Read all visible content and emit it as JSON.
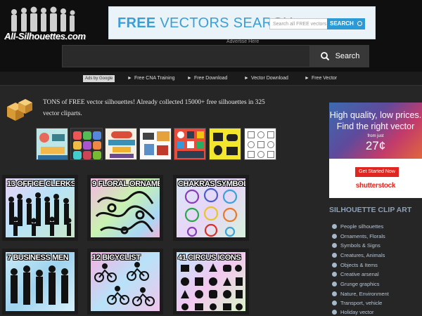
{
  "site": {
    "logo_text": "All-Silhouettes.com"
  },
  "ad_banner": {
    "prefix": "FREE",
    "rest": " VECTORS SEARCH",
    "input_placeholder": "Search all FREE vectors",
    "button_label": "SEARCH",
    "note": "Advertise Here"
  },
  "search": {
    "button_label": "Search",
    "value": ""
  },
  "link_bar": {
    "adchoices": "Ads by Google",
    "links": [
      "Free CNA Training",
      "Free Download",
      "Vector Download",
      "Free Vector"
    ]
  },
  "intro": {
    "text": "TONS of FREE vector silhouettes! Already collected 15000+ free silhouettes in 325 vector cliparts."
  },
  "cards": [
    {
      "title": "13 OFFICE CLERKS"
    },
    {
      "title": "9 FLORAL ORNAMENTS"
    },
    {
      "title": "CHAKRAS SYMBOLS"
    },
    {
      "title": "7 BUSINESS MEN"
    },
    {
      "title": "12 BICYCLIST"
    },
    {
      "title": "41 CIRCUS ICONS"
    }
  ],
  "promo": {
    "headline_1": "High quality, low prices.",
    "headline_2": "Find the right vector",
    "from": "from just",
    "price": "27¢",
    "cta": "Get Started Now",
    "brand": "shutterstock"
  },
  "sidebar": {
    "title": "SILHOUETTE CLIP ART",
    "categories": [
      "People silhouettes",
      "Ornaments, Florals",
      "Symbols & Signs",
      "Creatures, Animals",
      "Objects & Items",
      "Creative arsenal",
      "Grunge graphics",
      "Nature, Environment",
      "Transport, vehicle",
      "Holiday vector"
    ]
  },
  "colors": {
    "accent": "#3a9fd6",
    "cta_red": "#e02620",
    "bg": "#262626"
  }
}
